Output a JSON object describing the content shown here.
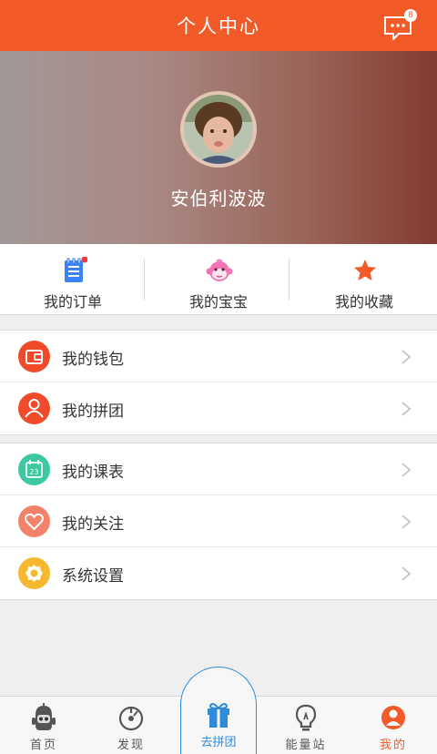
{
  "header": {
    "title": "个人中心",
    "message_badge": "8"
  },
  "profile": {
    "username": "安伯利波波"
  },
  "quick_actions": [
    {
      "label": "我的订单",
      "icon": "order-list-icon",
      "color": "#3b82f6",
      "has_dot": true
    },
    {
      "label": "我的宝宝",
      "icon": "monkey-face-icon",
      "color": "#f472b6"
    },
    {
      "label": "我的收藏",
      "icon": "star-icon",
      "color": "#f25b28"
    }
  ],
  "menu_group1": [
    {
      "label": "我的钱包",
      "icon": "wallet-icon",
      "color": "#ef4b2a"
    },
    {
      "label": "我的拼团",
      "icon": "user-group-icon",
      "color": "#ef4b2a"
    }
  ],
  "menu_group2": [
    {
      "label": "我的课表",
      "icon": "calendar-icon",
      "color": "#3cc8a0",
      "calendar_day": "23"
    },
    {
      "label": "我的关注",
      "icon": "heart-icon",
      "color": "#f3826a"
    },
    {
      "label": "系统设置",
      "icon": "settings-gear-icon",
      "color": "#f5b82e"
    }
  ],
  "tabbar": {
    "tabs": [
      {
        "label": "首页",
        "icon": "robot-icon"
      },
      {
        "label": "发现",
        "icon": "discover-compass-icon"
      },
      {
        "label": "去拼团",
        "icon": "gift-icon",
        "center": true
      },
      {
        "label": "能量站",
        "icon": "lightbulb-icon"
      },
      {
        "label": "我的",
        "icon": "user-profile-icon",
        "active": true
      }
    ],
    "accent": "#f25b28",
    "center_color": "#2e8bd8"
  }
}
